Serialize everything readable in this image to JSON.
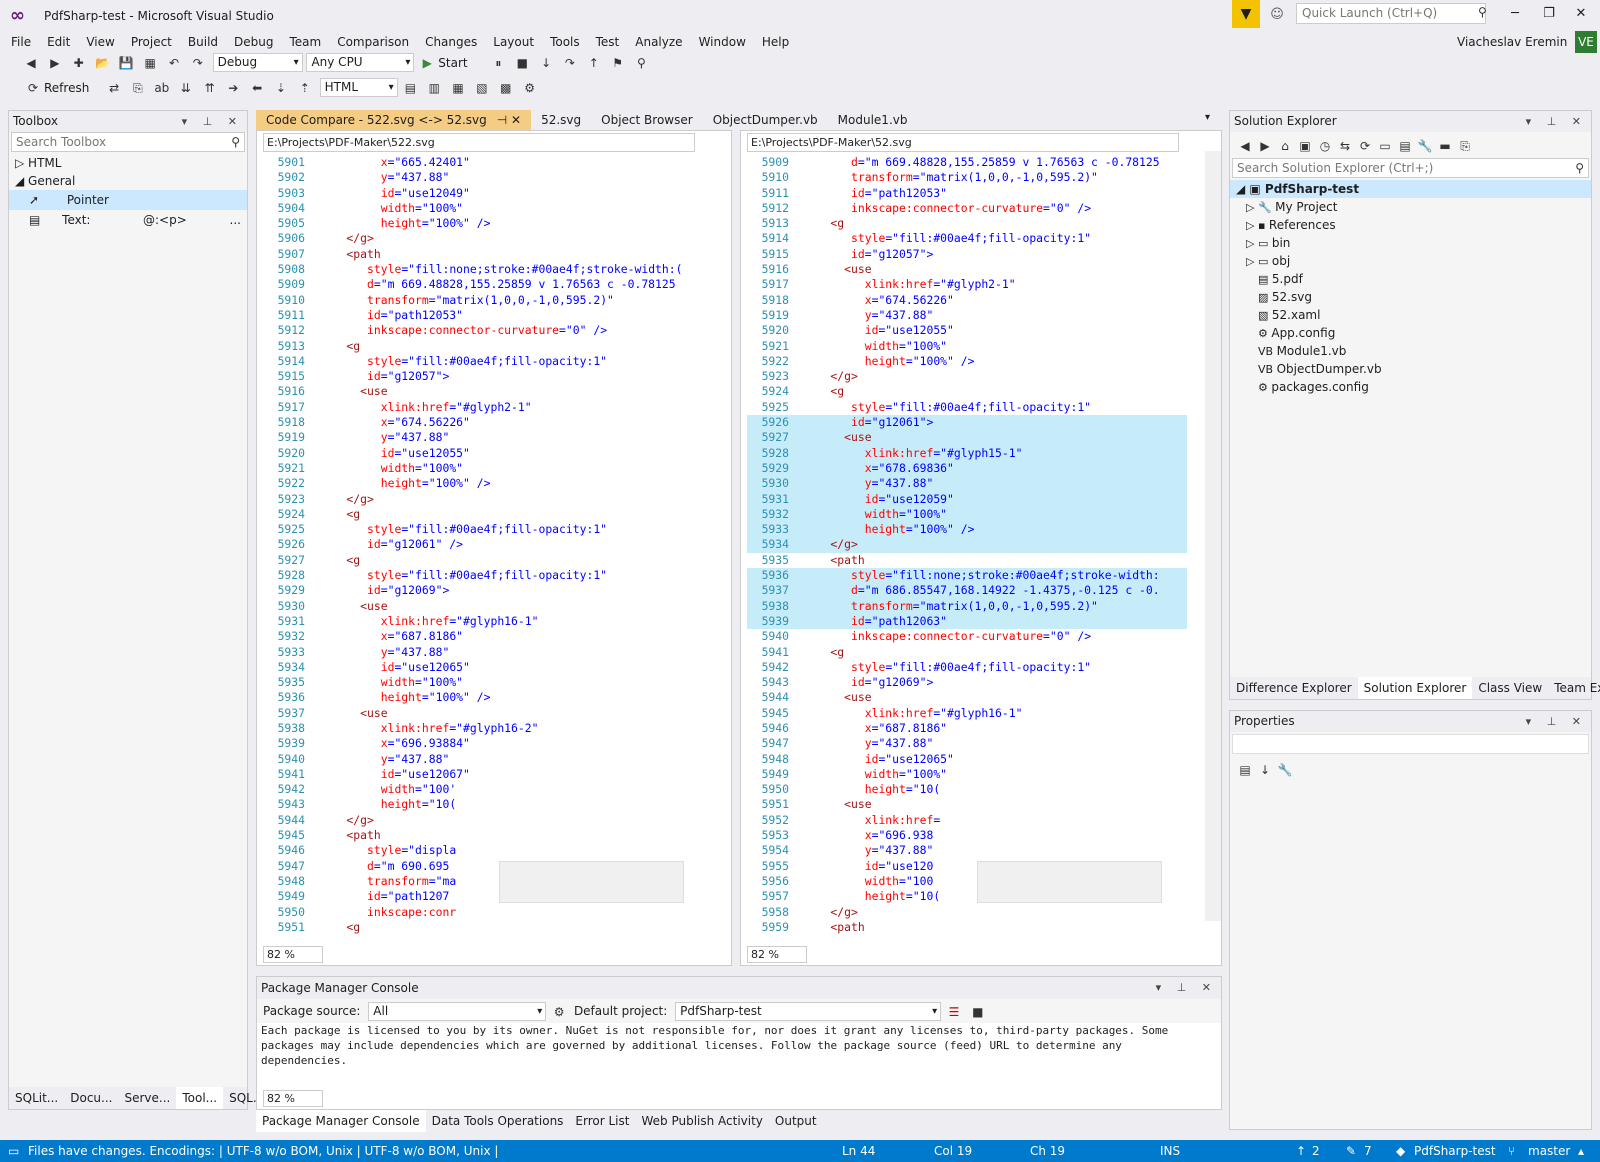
{
  "app": {
    "title": "PdfSharp-test - Microsoft Visual Studio",
    "quick_launch": "Quick Launch (Ctrl+Q)",
    "user": "Viacheslav Eremin",
    "avatar": "VE"
  },
  "menu": [
    "File",
    "Edit",
    "View",
    "Project",
    "Build",
    "Debug",
    "Team",
    "Comparison",
    "Changes",
    "Layout",
    "Tools",
    "Test",
    "Analyze",
    "Window",
    "Help"
  ],
  "toolbar": {
    "config": "Debug",
    "platform": "Any CPU",
    "start": "Start",
    "refresh": "Refresh",
    "lang": "HTML"
  },
  "toolbox": {
    "title": "Toolbox",
    "search": "Search Toolbox",
    "html": "HTML",
    "general": "General",
    "pointer": "Pointer",
    "text": "Text:",
    "text_val": "@:<p>",
    "more": "...",
    "tabs": [
      "SQLit...",
      "Docu...",
      "Serve...",
      "Tool...",
      "SQL..."
    ]
  },
  "doc_tabs": [
    "Code Compare - 522.svg <-> 52.svg",
    "52.svg",
    "Object Browser",
    "ObjectDumper.vb",
    "Module1.vb"
  ],
  "left_editor": {
    "path": "E:\\Projects\\PDF-Maker\\522.svg",
    "zoom": "82 %",
    "lines": [
      [
        "5901",
        "         ",
        "x",
        "=\"665.42401\""
      ],
      [
        "5902",
        "         ",
        "y",
        "=\"437.88\""
      ],
      [
        "5903",
        "         ",
        "id",
        "=\"use12049\""
      ],
      [
        "5904",
        "         ",
        "width",
        "=\"100%\""
      ],
      [
        "5905",
        "         ",
        "height",
        "=\"100%\" />"
      ],
      [
        "5906",
        "    </g>",
        "",
        ""
      ],
      [
        "5907",
        "    <path",
        "",
        ""
      ],
      [
        "5908",
        "       ",
        "style",
        "=\"fill:none;stroke:#00ae4f;stroke-width:("
      ],
      [
        "5909",
        "       ",
        "d",
        "=\"m 669.48828,155.25859 v 1.76563 c -0.78125"
      ],
      [
        "5910",
        "       ",
        "transform",
        "=\"matrix(1,0,0,-1,0,595.2)\""
      ],
      [
        "5911",
        "       ",
        "id",
        "=\"path12053\""
      ],
      [
        "5912",
        "       ",
        "inkscape:connector-curvature",
        "=\"0\" />"
      ],
      [
        "5913",
        "    <g",
        "",
        ""
      ],
      [
        "5914",
        "       ",
        "style",
        "=\"fill:#00ae4f;fill-opacity:1\""
      ],
      [
        "5915",
        "       ",
        "id",
        "=\"g12057\">"
      ],
      [
        "5916",
        "      <use",
        "",
        ""
      ],
      [
        "5917",
        "         ",
        "xlink:href",
        "=\"#glyph2-1\""
      ],
      [
        "5918",
        "         ",
        "x",
        "=\"674.56226\""
      ],
      [
        "5919",
        "         ",
        "y",
        "=\"437.88\""
      ],
      [
        "5920",
        "         ",
        "id",
        "=\"use12055\""
      ],
      [
        "5921",
        "         ",
        "width",
        "=\"100%\""
      ],
      [
        "5922",
        "         ",
        "height",
        "=\"100%\" />"
      ],
      [
        "5923",
        "    </g>",
        "",
        ""
      ],
      [
        "5924",
        "    <g",
        "",
        ""
      ],
      [
        "5925",
        "       ",
        "style",
        "=\"fill:#00ae4f;fill-opacity:1\""
      ],
      [
        "5926",
        "       ",
        "id",
        "=\"g12061\" />"
      ],
      [
        "5927",
        "    <g",
        "",
        ""
      ],
      [
        "5928",
        "       ",
        "style",
        "=\"fill:#00ae4f;fill-opacity:1\""
      ],
      [
        "5929",
        "       ",
        "id",
        "=\"g12069\">"
      ],
      [
        "5930",
        "      <use",
        "",
        ""
      ],
      [
        "5931",
        "         ",
        "xlink:href",
        "=\"#glyph16-1\""
      ],
      [
        "5932",
        "         ",
        "x",
        "=\"687.8186\""
      ],
      [
        "5933",
        "         ",
        "y",
        "=\"437.88\""
      ],
      [
        "5934",
        "         ",
        "id",
        "=\"use12065\""
      ],
      [
        "5935",
        "         ",
        "width",
        "=\"100%\""
      ],
      [
        "5936",
        "         ",
        "height",
        "=\"100%\" />"
      ],
      [
        "5937",
        "      <use",
        "",
        ""
      ],
      [
        "5938",
        "         ",
        "xlink:href",
        "=\"#glyph16-2\""
      ],
      [
        "5939",
        "         ",
        "x",
        "=\"696.93884\""
      ],
      [
        "5940",
        "         ",
        "y",
        "=\"437.88\""
      ],
      [
        "5941",
        "         ",
        "id",
        "=\"use12067\""
      ],
      [
        "5942",
        "         ",
        "width",
        "=\"100'"
      ],
      [
        "5943",
        "         ",
        "height",
        "=\"10("
      ],
      [
        "5944",
        "    </g>",
        "",
        ""
      ],
      [
        "5945",
        "    <path",
        "",
        ""
      ],
      [
        "5946",
        "       ",
        "style",
        "=\"displa"
      ],
      [
        "5947",
        "       ",
        "d",
        "=\"m 690.695"
      ],
      [
        "5948",
        "       ",
        "transform",
        "=\"ma"
      ],
      [
        "5949",
        "       ",
        "id",
        "=\"path1207"
      ],
      [
        "5950",
        "       ",
        "inkscape:conr",
        ""
      ],
      [
        "5951",
        "    <g",
        "",
        ""
      ]
    ]
  },
  "right_editor": {
    "path": "E:\\Projects\\PDF-Maker\\52.svg",
    "zoom": "82 %",
    "lines": [
      [
        "5909",
        "       ",
        "d",
        "=\"m 669.48828,155.25859 v 1.76563 c -0.78125",
        ""
      ],
      [
        "5910",
        "       ",
        "transform",
        "=\"matrix(1,0,0,-1,0,595.2)\"",
        ""
      ],
      [
        "5911",
        "       ",
        "id",
        "=\"path12053\"",
        ""
      ],
      [
        "5912",
        "       ",
        "inkscape:connector-curvature",
        "=\"0\" />",
        ""
      ],
      [
        "5913",
        "    <g",
        "",
        "",
        ""
      ],
      [
        "5914",
        "       ",
        "style",
        "=\"fill:#00ae4f;fill-opacity:1\"",
        ""
      ],
      [
        "5915",
        "       ",
        "id",
        "=\"g12057\">",
        ""
      ],
      [
        "5916",
        "      <use",
        "",
        "",
        ""
      ],
      [
        "5917",
        "         ",
        "xlink:href",
        "=\"#glyph2-1\"",
        ""
      ],
      [
        "5918",
        "         ",
        "x",
        "=\"674.56226\"",
        ""
      ],
      [
        "5919",
        "         ",
        "y",
        "=\"437.88\"",
        ""
      ],
      [
        "5920",
        "         ",
        "id",
        "=\"use12055\"",
        ""
      ],
      [
        "5921",
        "         ",
        "width",
        "=\"100%\"",
        ""
      ],
      [
        "5922",
        "         ",
        "height",
        "=\"100%\" />",
        ""
      ],
      [
        "5923",
        "    </g>",
        "",
        "",
        ""
      ],
      [
        "5924",
        "    <g",
        "",
        "",
        ""
      ],
      [
        "5925",
        "       ",
        "style",
        "=\"fill:#00ae4f;fill-opacity:1\"",
        ""
      ],
      [
        "5926",
        "       ",
        "id",
        "=\"g12061\">",
        "hl"
      ],
      [
        "5927",
        "      <use",
        "",
        "",
        "hl"
      ],
      [
        "5928",
        "         ",
        "xlink:href",
        "=\"#glyph15-1\"",
        "hl"
      ],
      [
        "5929",
        "         ",
        "x",
        "=\"678.69836\"",
        "hl"
      ],
      [
        "5930",
        "         ",
        "y",
        "=\"437.88\"",
        "hl"
      ],
      [
        "5931",
        "         ",
        "id",
        "=\"use12059\"",
        "hl"
      ],
      [
        "5932",
        "         ",
        "width",
        "=\"100%\"",
        "hl"
      ],
      [
        "5933",
        "         ",
        "height",
        "=\"100%\" />",
        "hl"
      ],
      [
        "5934",
        "    </g>",
        "",
        "",
        "hl"
      ],
      [
        "5935",
        "    <path",
        "",
        "",
        ""
      ],
      [
        "5936",
        "       ",
        "style",
        "=\"fill:none;stroke:#00ae4f;stroke-width:",
        "hl"
      ],
      [
        "5937",
        "       ",
        "d",
        "=\"m 686.85547,168.14922 -1.4375,-0.125 c -0.",
        "hl"
      ],
      [
        "5938",
        "       ",
        "transform",
        "=\"matrix(1,0,0,-1,0,595.2)\"",
        "hl"
      ],
      [
        "5939",
        "       ",
        "id",
        "=\"path12063\"",
        "hl"
      ],
      [
        "5940",
        "       ",
        "inkscape:connector-curvature",
        "=\"0\" />",
        ""
      ],
      [
        "5941",
        "    <g",
        "",
        "",
        ""
      ],
      [
        "5942",
        "       ",
        "style",
        "=\"fill:#00ae4f;fill-opacity:1\"",
        ""
      ],
      [
        "5943",
        "       ",
        "id",
        "=\"g12069\">",
        ""
      ],
      [
        "5944",
        "      <use",
        "",
        "",
        ""
      ],
      [
        "5945",
        "         ",
        "xlink:href",
        "=\"#glyph16-1\"",
        ""
      ],
      [
        "5946",
        "         ",
        "x",
        "=\"687.8186\"",
        ""
      ],
      [
        "5947",
        "         ",
        "y",
        "=\"437.88\"",
        ""
      ],
      [
        "5948",
        "         ",
        "id",
        "=\"use12065\"",
        ""
      ],
      [
        "5949",
        "         ",
        "width",
        "=\"100%\"",
        ""
      ],
      [
        "5950",
        "         ",
        "height",
        "=\"10(",
        ""
      ],
      [
        "5951",
        "      <use",
        "",
        "",
        ""
      ],
      [
        "5952",
        "         ",
        "xlink:href",
        "=",
        ""
      ],
      [
        "5953",
        "         ",
        "x",
        "=\"696.938",
        ""
      ],
      [
        "5954",
        "         ",
        "y",
        "=\"437.88\"",
        ""
      ],
      [
        "5955",
        "         ",
        "id",
        "=\"use120",
        ""
      ],
      [
        "5956",
        "         ",
        "width",
        "=\"100",
        ""
      ],
      [
        "5957",
        "         ",
        "height",
        "=\"10(",
        ""
      ],
      [
        "5958",
        "    </g>",
        "",
        "",
        ""
      ],
      [
        "5959",
        "    <path",
        "",
        "",
        ""
      ]
    ]
  },
  "solution_explorer": {
    "title": "Solution Explorer",
    "search": "Search Solution Explorer (Ctrl+;)",
    "root": "PdfSharp-test",
    "items": [
      "My Project",
      "References",
      "bin",
      "obj",
      "5.pdf",
      "52.svg",
      "52.xaml",
      "App.config",
      "Module1.vb",
      "ObjectDumper.vb",
      "packages.config"
    ],
    "tabs": [
      "Difference Explorer",
      "Solution Explorer",
      "Class View",
      "Team Explorer"
    ]
  },
  "properties": {
    "title": "Properties"
  },
  "pmc": {
    "title": "Package Manager Console",
    "source_label": "Package source:",
    "source": "All",
    "project_label": "Default project:",
    "project": "PdfSharp-test",
    "text": "Each package is licensed to you by its owner. NuGet is not responsible for, nor does it grant any licenses to, third-party packages. Some\npackages may include dependencies which are governed by additional licenses. Follow the package source (feed) URL to determine any\ndependencies.",
    "zoom": "82 %"
  },
  "bottom_tabs": [
    "Package Manager Console",
    "Data Tools Operations",
    "Error List",
    "Web Publish Activity",
    "Output"
  ],
  "status": {
    "message": "Files have changes. Encodings: | UTF-8 w/o BOM, Unix | UTF-8 w/o BOM, Unix |",
    "ln": "Ln 44",
    "col": "Col 19",
    "ch": "Ch 19",
    "ins": "INS",
    "up": "2",
    "edits": "7",
    "project": "PdfSharp-test",
    "branch": "master"
  },
  "colors": {
    "accent": "#007acc",
    "tab_active": "#f5cc84",
    "diff_highlight": "#c7ecf9",
    "filter": "#f3c300"
  }
}
